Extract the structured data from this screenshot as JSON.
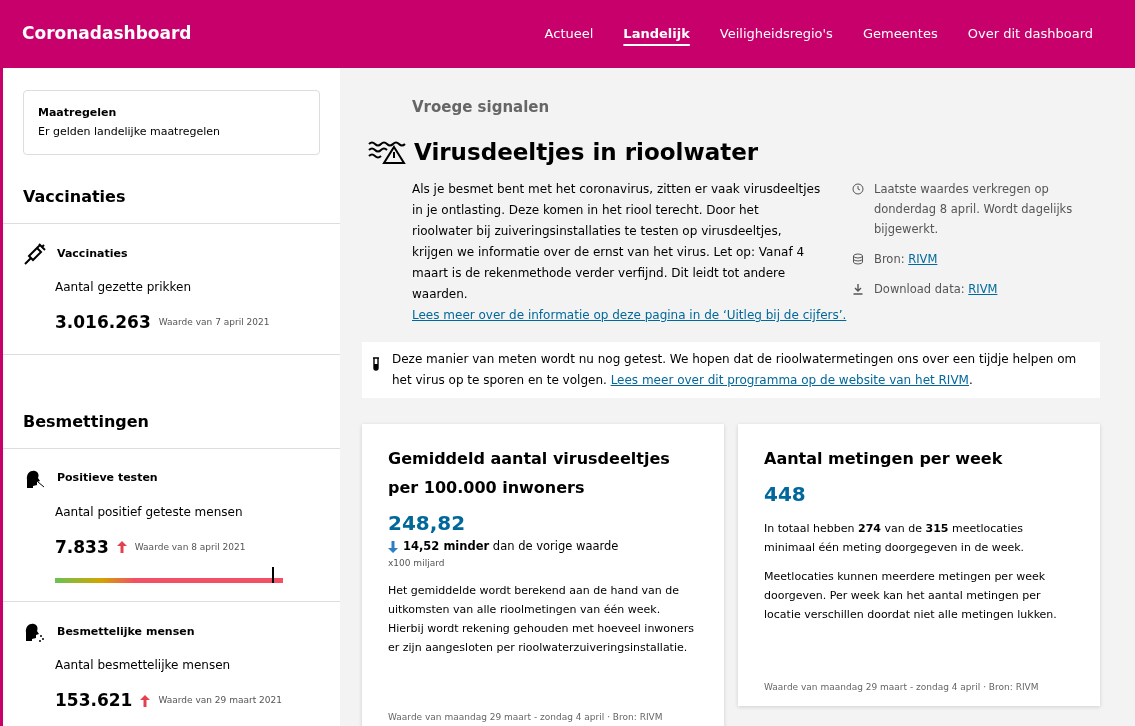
{
  "header": {
    "title": "Coronadashboard",
    "nav": [
      {
        "label": "Actueel",
        "selected": false
      },
      {
        "label": "Landelijk",
        "selected": true
      },
      {
        "label": "Veiligheidsregio's",
        "selected": false
      },
      {
        "label": "Gemeentes",
        "selected": false
      },
      {
        "label": "Over dit dashboard",
        "selected": false
      }
    ]
  },
  "sidebar": {
    "notice": {
      "title": "Maatregelen",
      "text": "Er gelden landelijke maatregelen"
    },
    "sections": [
      {
        "heading": "Vaccinaties",
        "items": [
          {
            "kind": "syringe",
            "title": "Vaccinaties",
            "description": "Aantal gezette prikken",
            "value": "3.016.263",
            "rising": false,
            "date": "Waarde van 7 april 2021"
          }
        ]
      },
      {
        "heading": "Besmettingen",
        "items": [
          {
            "kind": "test",
            "title": "Positieve testen",
            "description": "Aantal positief geteste mensen",
            "value": "7.833",
            "rising": true,
            "date": "Waarde van 8 april 2021",
            "bar": {
              "level": 0.95
            }
          },
          {
            "kind": "contagious",
            "title": "Besmettelijke mensen",
            "description": "Aantal besmettelijke mensen",
            "value": "153.621",
            "rising": true,
            "date": "Waarde van 29 maart 2021"
          }
        ]
      }
    ]
  },
  "main": {
    "section_label": "Vroege signalen",
    "title": "Virusdeeltjes in rioolwater",
    "intro": {
      "text": "Als je besmet bent met het coronavirus, zitten er vaak virusdeeltjes in je ontlasting. Deze komen in het riool terecht. Door het rioolwater bij zuiveringsinstallaties te testen op virusdeeltjes, krijgen we informatie over de ernst van het virus. Let op: Vanaf 4 maart is de rekenmethode verder verfijnd. Dit leidt tot andere waarden.",
      "link": "Lees meer over de informatie op deze pagina in de ‘Uitleg bij de cijfers’."
    },
    "meta": [
      {
        "kind": "time",
        "text": "Laatste waardes verkregen op donderdag 8 april. Wordt dagelijks bijgewerkt."
      },
      {
        "kind": "source",
        "text": "Bron:",
        "link": "RIVM"
      },
      {
        "kind": "download",
        "text": "Download data:",
        "link": "RIVM"
      }
    ],
    "notice": {
      "text": "Deze manier van meten wordt nu nog getest. We hopen dat de rioolwatermetingen ons over een tijdje helpen om het virus op te sporen en te volgen.",
      "link": "Lees meer over dit programma op de website van het RIVM",
      "after": "."
    },
    "cards": [
      {
        "title": "Gemiddeld aantal virusdeeltjes per 100.000 inwoners",
        "value": "248,82",
        "change": {
          "decreased": true,
          "amount": "14,52 minder",
          "text": "dan de vorige waarde"
        },
        "unit": "x100 miljard",
        "paragraphs": [
          "Het gemiddelde wordt berekend aan de hand van de uitkomsten van alle rioolmetingen van één week. Hierbij wordt rekening gehouden met hoeveel inwoners er zijn aangesloten per rioolwaterzuiveringsinstallatie."
        ],
        "footer": "Waarde van maandag 29 maart - zondag 4 april · Bron: RIVM"
      },
      {
        "title": "Aantal metingen per week",
        "value": "448",
        "paragraphs": [
          "In totaal hebben **274** van de **315** meetlocaties minimaal één meting doorgegeven in de week.",
          "Meetlocaties kunnen meerdere metingen per week doorgeven. Per week kan het aantal metingen per locatie verschillen doordat niet alle metingen lukken."
        ],
        "footer": "Waarde van maandag 29 maart - zondag 4 april · Bron: RIVM"
      }
    ]
  }
}
